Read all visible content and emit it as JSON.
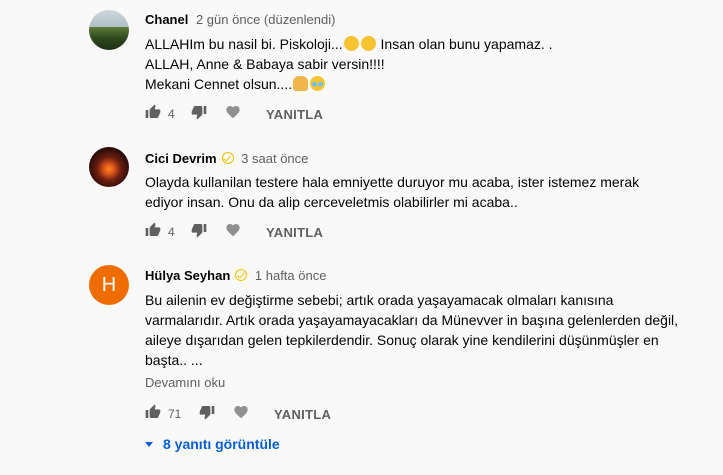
{
  "comments": [
    {
      "author": "Chanel",
      "date": "2 gün önce (düzenlendi)",
      "verified": false,
      "avatar": "landscape-photo",
      "lines": [
        "ALLAHIm bu nasil  bi. Piskoloji...",
        " Insan olan bunu yapamaz. .",
        "ALLAH, Anne & Babaya sabir versin!!!!",
        "Mekani Cennet olsun...."
      ],
      "likes": "4",
      "reply_label": "YANITLA"
    },
    {
      "author": "Cici Devrim",
      "date": "3 saat önce",
      "verified": true,
      "avatar": "fire-photo",
      "lines": [
        "Olayda kullanilan testere hala emniyette duruyor mu acaba, ister istemez merak",
        "ediyor insan. Onu da alip cerceveletmis olabilirler mi acaba.."
      ],
      "likes": "4",
      "reply_label": "YANITLA"
    },
    {
      "author": "Hülya Seyhan",
      "date": "1 hafta önce",
      "verified": true,
      "avatar_letter": "H",
      "lines": [
        "Bu ailenin ev değiştirme sebebi; artık orada yaşayamacak olmaları kanısına",
        "varmalarıdır. Artık orada yaşayamayacakları da Münevver in başına gelenlerden değil,",
        "aileye dışarıdan gelen tepkilerdendir. Sonuç olarak yine kendilerini düşünmüşler en",
        "başta.. ..."
      ],
      "read_more": "Devamını oku",
      "likes": "71",
      "reply_label": "YANITLA"
    }
  ],
  "view_replies": "8 yanıtı görüntüle",
  "colors": {
    "background": "#f9f9f9",
    "link": "#065fd4",
    "secondary_text": "#606060",
    "verified": "#f2c200",
    "avatar_h": "#ef6c00"
  },
  "icons": [
    "thumb-up-icon",
    "thumb-down-icon",
    "heart-icon",
    "verified-icon",
    "caret-down-icon"
  ]
}
